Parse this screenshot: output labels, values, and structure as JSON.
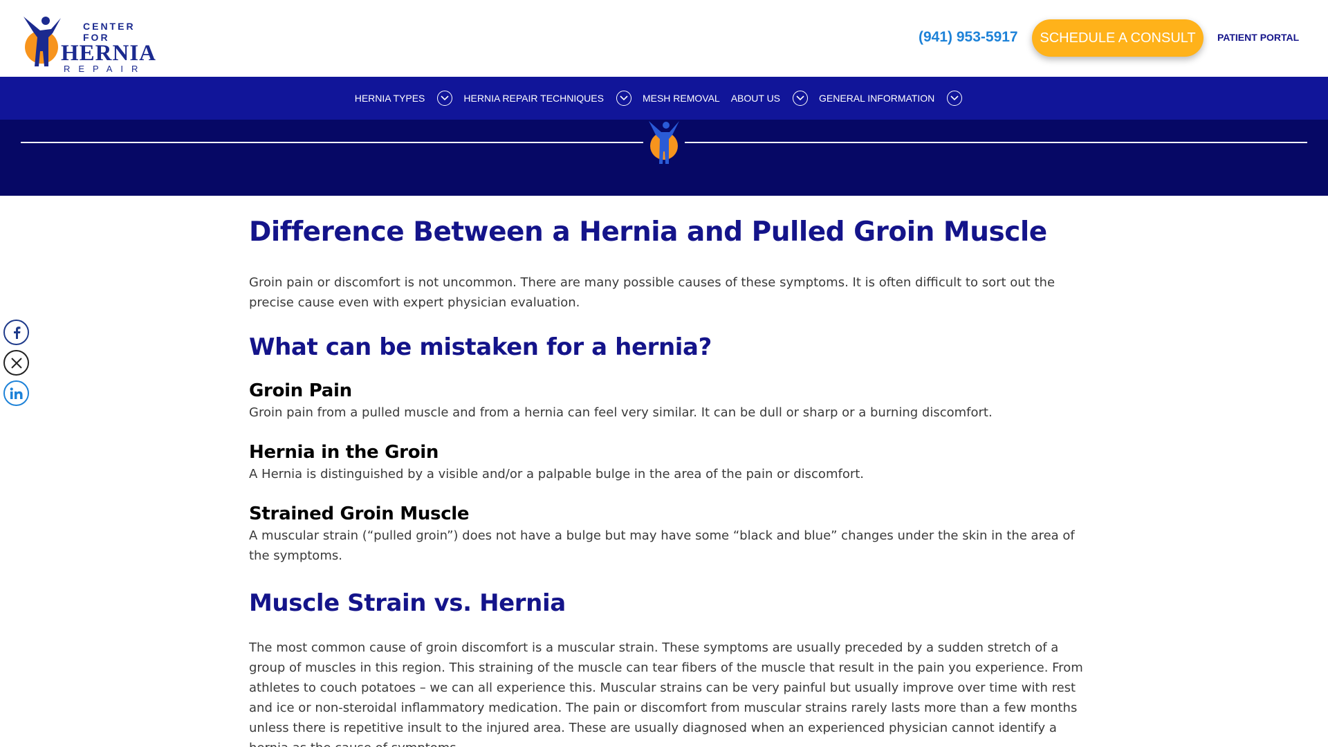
{
  "header": {
    "logo": {
      "line1": "CENTER FOR",
      "line2": "HERNIA",
      "line3": "REPAIR",
      "colors": {
        "navy": "#1b2a8f",
        "orange": "#f7941d"
      }
    },
    "phone": "(941) 953-5917",
    "consult_label": "SCHEDULE A CONSULT",
    "portal_label": "PATIENT PORTAL"
  },
  "nav": {
    "items": [
      {
        "label": "HERNIA TYPES",
        "icon": "chevron-down-icon"
      },
      {
        "label": "HERNIA REPAIR TECHNIQUES",
        "icon": "chevron-down-icon"
      },
      {
        "label": "MESH REMOVAL"
      },
      {
        "label": "ABOUT US",
        "icon": "chevron-down-icon"
      },
      {
        "label": "GENERAL INFORMATION",
        "icon": "chevron-down-icon"
      }
    ]
  },
  "social": [
    {
      "icon": "facebook-icon"
    },
    {
      "icon": "x-icon"
    },
    {
      "icon": "linkedin-icon"
    }
  ],
  "article": {
    "title": "Difference Between a Hernia and Pulled Groin Muscle",
    "intro": "Groin pain or discomfort is not uncommon. There are many possible causes of these symptoms. It is often difficult to sort out the precise cause even with expert physician evaluation.",
    "section1_heading": "What can be mistaken for a hernia?",
    "sub1_heading": "Groin Pain",
    "sub1_text": "Groin pain from a pulled muscle and from a hernia can feel very similar. It can be dull or sharp or a burning discomfort.",
    "sub2_heading": "Hernia in the Groin",
    "sub2_text": "A Hernia is distinguished by a visible and/or a palpable bulge in the area of the pain or discomfort.",
    "sub3_heading": "Strained Groin Muscle",
    "sub3_text": "A muscular strain (“pulled groin”) does not have a bulge but may have some “black and blue” changes under the skin in the area of the symptoms.",
    "section2_heading": "Muscle Strain vs. Hernia",
    "section2_text": "The most common cause of groin discomfort is a muscular strain. These symptoms are usually preceded by a sudden stretch of a group of muscles in this region. This straining of the muscle can tear fibers of the muscle that result in the pain you experience. From athletes to couch potatoes – we can all experience this. Muscular strains can be very painful but usually improve over time with rest and ice or non-steroidal inflammatory medication. The pain or discomfort from muscular strains rarely lasts more than a few months unless there is repetitive insult to the injured area. These are usually diagnosed when an experienced physician cannot identify a hernia as the cause of symptoms."
  },
  "colors": {
    "nav_bg": "#111599",
    "banner_bg": "#060865",
    "heading": "#14148a",
    "accent_orange": "#ffb21a",
    "phone_blue": "#1d82d8"
  }
}
